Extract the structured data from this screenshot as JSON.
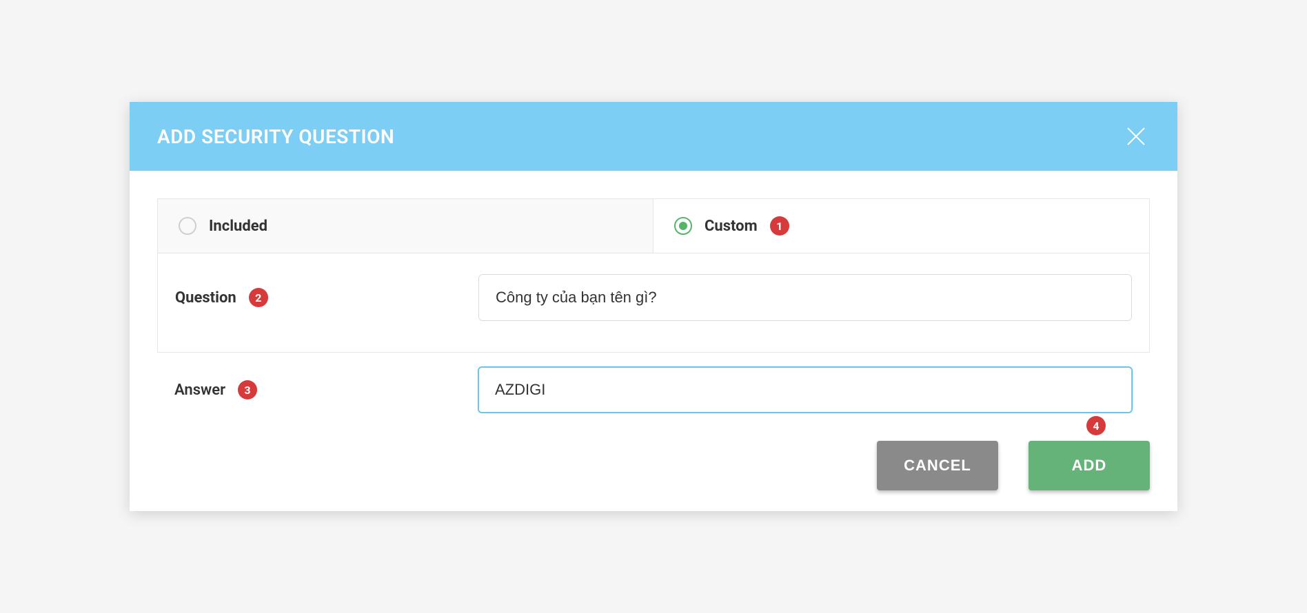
{
  "modal": {
    "title": "ADD SECURITY QUESTION",
    "tabs": {
      "included": {
        "label": "Included",
        "selected": false
      },
      "custom": {
        "label": "Custom",
        "selected": true,
        "badge": "1"
      }
    },
    "question": {
      "label": "Question",
      "badge": "2",
      "value": "Công ty của bạn tên gì?"
    },
    "answer": {
      "label": "Answer",
      "badge": "3",
      "value": "AZDIGI"
    },
    "buttons": {
      "cancel": "CANCEL",
      "add": "ADD",
      "add_badge": "4"
    }
  }
}
